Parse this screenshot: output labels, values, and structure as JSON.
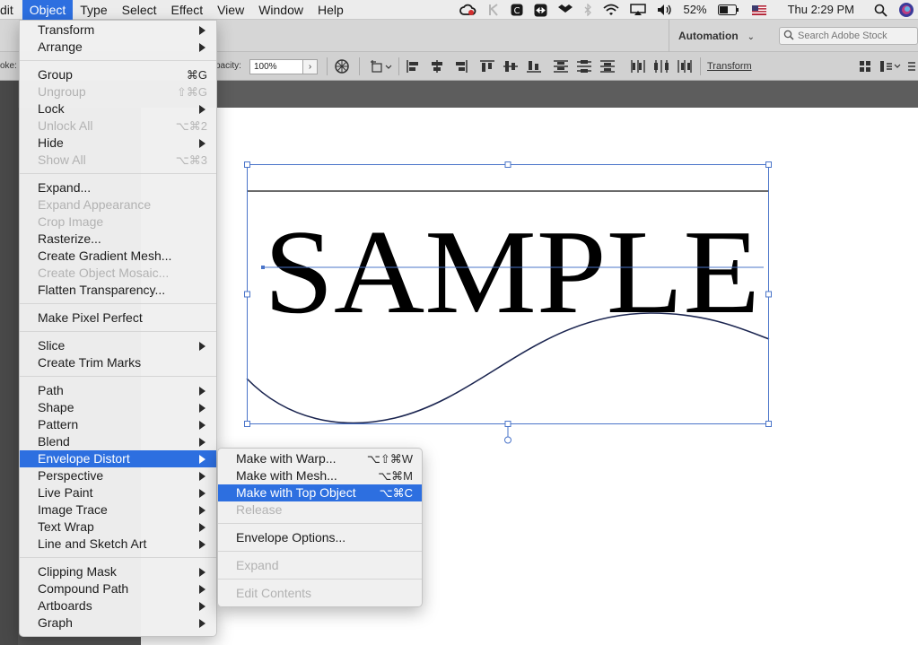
{
  "menubar": {
    "items": [
      {
        "label": "dit"
      },
      {
        "label": "Object"
      },
      {
        "label": "Type"
      },
      {
        "label": "Select"
      },
      {
        "label": "Effect"
      },
      {
        "label": "View"
      },
      {
        "label": "Window"
      },
      {
        "label": "Help"
      }
    ],
    "status": {
      "battery": "52%",
      "clock": "Thu 2:29 PM"
    }
  },
  "appbar": {
    "workspace": "Automation",
    "search_placeholder": "Search Adobe Stock"
  },
  "controlbar": {
    "stroke_label": "oke:",
    "opacity_label": "pacity:",
    "opacity_value": "100%",
    "transform_link": "Transform"
  },
  "canvas": {
    "sample_text": "SAMPLE"
  },
  "object_menu": {
    "items": [
      {
        "label": "Transform",
        "shortcut": "",
        "submenu": true,
        "disabled": false
      },
      {
        "label": "Arrange",
        "shortcut": "",
        "submenu": true,
        "disabled": false
      },
      {
        "label": "Group",
        "shortcut": "⌘G",
        "submenu": false,
        "disabled": false
      },
      {
        "label": "Ungroup",
        "shortcut": "⇧⌘G",
        "submenu": false,
        "disabled": true
      },
      {
        "label": "Lock",
        "shortcut": "",
        "submenu": true,
        "disabled": false
      },
      {
        "label": "Unlock All",
        "shortcut": "⌥⌘2",
        "submenu": false,
        "disabled": true
      },
      {
        "label": "Hide",
        "shortcut": "",
        "submenu": true,
        "disabled": false
      },
      {
        "label": "Show All",
        "shortcut": "⌥⌘3",
        "submenu": false,
        "disabled": true
      },
      {
        "label": "Expand...",
        "shortcut": "",
        "submenu": false,
        "disabled": false
      },
      {
        "label": "Expand Appearance",
        "shortcut": "",
        "submenu": false,
        "disabled": true
      },
      {
        "label": "Crop Image",
        "shortcut": "",
        "submenu": false,
        "disabled": true
      },
      {
        "label": "Rasterize...",
        "shortcut": "",
        "submenu": false,
        "disabled": false
      },
      {
        "label": "Create Gradient Mesh...",
        "shortcut": "",
        "submenu": false,
        "disabled": false
      },
      {
        "label": "Create Object Mosaic...",
        "shortcut": "",
        "submenu": false,
        "disabled": true
      },
      {
        "label": "Flatten Transparency...",
        "shortcut": "",
        "submenu": false,
        "disabled": false
      },
      {
        "label": "Make Pixel Perfect",
        "shortcut": "",
        "submenu": false,
        "disabled": false
      },
      {
        "label": "Slice",
        "shortcut": "",
        "submenu": true,
        "disabled": false
      },
      {
        "label": "Create Trim Marks",
        "shortcut": "",
        "submenu": false,
        "disabled": false
      },
      {
        "label": "Path",
        "shortcut": "",
        "submenu": true,
        "disabled": false
      },
      {
        "label": "Shape",
        "shortcut": "",
        "submenu": true,
        "disabled": false
      },
      {
        "label": "Pattern",
        "shortcut": "",
        "submenu": true,
        "disabled": false
      },
      {
        "label": "Blend",
        "shortcut": "",
        "submenu": true,
        "disabled": false
      },
      {
        "label": "Envelope Distort",
        "shortcut": "",
        "submenu": true,
        "disabled": false
      },
      {
        "label": "Perspective",
        "shortcut": "",
        "submenu": true,
        "disabled": false
      },
      {
        "label": "Live Paint",
        "shortcut": "",
        "submenu": true,
        "disabled": false
      },
      {
        "label": "Image Trace",
        "shortcut": "",
        "submenu": true,
        "disabled": false
      },
      {
        "label": "Text Wrap",
        "shortcut": "",
        "submenu": true,
        "disabled": false
      },
      {
        "label": "Line and Sketch Art",
        "shortcut": "",
        "submenu": true,
        "disabled": false
      },
      {
        "label": "Clipping Mask",
        "shortcut": "",
        "submenu": true,
        "disabled": false
      },
      {
        "label": "Compound Path",
        "shortcut": "",
        "submenu": true,
        "disabled": false
      },
      {
        "label": "Artboards",
        "shortcut": "",
        "submenu": true,
        "disabled": false
      },
      {
        "label": "Graph",
        "shortcut": "",
        "submenu": true,
        "disabled": false
      }
    ]
  },
  "envelope_menu": {
    "items": [
      {
        "label": "Make with Warp...",
        "shortcut": "⌥⇧⌘W",
        "disabled": false
      },
      {
        "label": "Make with Mesh...",
        "shortcut": "⌥⌘M",
        "disabled": false
      },
      {
        "label": "Make with Top Object",
        "shortcut": "⌥⌘C",
        "disabled": false
      },
      {
        "label": "Release",
        "shortcut": "",
        "disabled": true
      },
      {
        "label": "Envelope Options...",
        "shortcut": "",
        "disabled": false
      },
      {
        "label": "Expand",
        "shortcut": "",
        "disabled": true
      },
      {
        "label": "Edit Contents",
        "shortcut": "",
        "disabled": true
      }
    ]
  },
  "colors": {
    "highlight": "#2d6fe0",
    "selection": "#4a74c9"
  }
}
